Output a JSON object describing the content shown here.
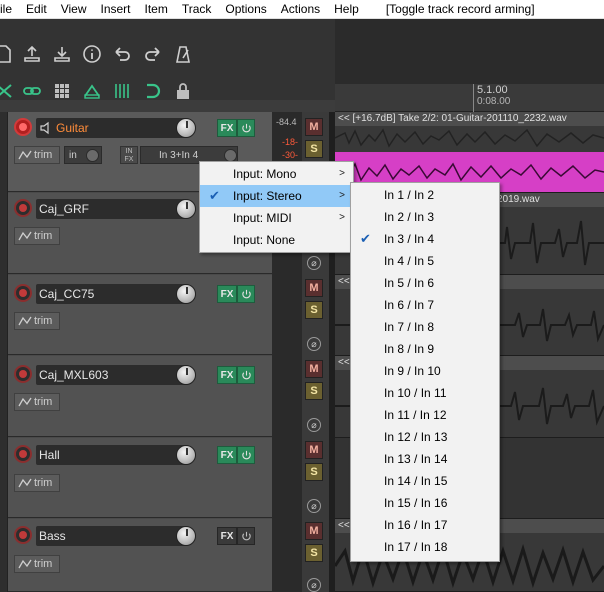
{
  "menubar": {
    "items": [
      "ile",
      "Edit",
      "View",
      "Insert",
      "Item",
      "Track",
      "Options",
      "Actions",
      "Help"
    ],
    "status": "[Toggle track record arming]"
  },
  "ruler": {
    "bar": "5.1.00",
    "time": "0:08.00"
  },
  "tracks": [
    {
      "name": "Guitar",
      "trim": "trim",
      "input_mode": "in",
      "input_label": "In 3+In 4",
      "fx": "FX",
      "peak_top": "-84.4",
      "peak_mid": "-18-",
      "peak_low": "-30-"
    },
    {
      "name": "Caj_GRF",
      "trim": "trim"
    },
    {
      "name": "Caj_CC75",
      "trim": "trim",
      "fx": "FX"
    },
    {
      "name": "Caj_MXL603",
      "trim": "trim",
      "fx": "FX"
    },
    {
      "name": "Hall",
      "trim": "trim",
      "fx": "FX"
    },
    {
      "name": "Bass",
      "trim": "trim",
      "fx": "FX"
    }
  ],
  "buttons": {
    "mute": "M",
    "solo": "S",
    "phase": "⌀"
  },
  "items": [
    "<< [+16.7dB] Take 2/2: 01-Guitar-201110_2232.wav",
    "2019.wav",
    "<< 2019.wav",
    "<< 3_2019.wav",
    "<< .wav"
  ],
  "input_menu": {
    "items": [
      {
        "label": "Input: Mono",
        "submenu": true,
        "checked": false
      },
      {
        "label": "Input: Stereo",
        "submenu": true,
        "checked": true
      },
      {
        "label": "Input: MIDI",
        "submenu": true,
        "checked": false
      },
      {
        "label": "Input: None",
        "submenu": false,
        "checked": false
      }
    ]
  },
  "stereo_submenu": {
    "items": [
      "In 1 / In 2",
      "In 2 / In 3",
      "In 3 / In 4",
      "In 4 / In 5",
      "In 5 / In 6",
      "In 6 / In 7",
      "In 7 / In 8",
      "In 8 / In 9",
      "In 9 / In 10",
      "In 10 / In 11",
      "In 11 / In 12",
      "In 12 / In 13",
      "In 13 / In 14",
      "In 14 / In 15",
      "In 15 / In 16",
      "In 16 / In 17",
      "In 17 / In 18"
    ],
    "checked": "In 3 / In 4"
  },
  "colors": {
    "fx_on": "#2a8a5a",
    "selected_track_name": "#ff8c3a",
    "menu_highlight": "#91c9f7",
    "guitar_wave": "#d63fc6"
  }
}
